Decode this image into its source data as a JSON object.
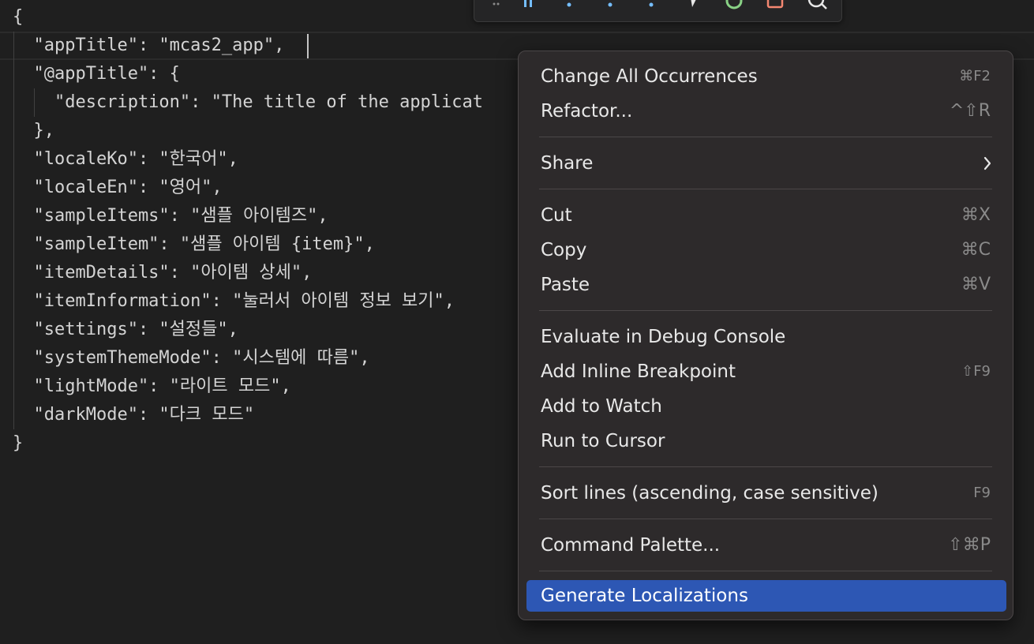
{
  "editor": {
    "lines": [
      "{",
      "  \"appTitle\": \"mcas2_app\",",
      "  \"@appTitle\": {",
      "    \"description\": \"The title of the applicat",
      "  },",
      "  \"localeKo\": \"한국어\",",
      "  \"localeEn\": \"영어\",",
      "  \"sampleItems\": \"샘플 아이템즈\",",
      "  \"sampleItem\": \"샘플 아이템 {item}\",",
      "  \"itemDetails\": \"아이템 상세\",",
      "  \"itemInformation\": \"눌러서 아이템 정보 보기\",",
      "  \"settings\": \"설정들\",",
      "  \"systemThemeMode\": \"시스템에 따름\",",
      "  \"lightMode\": \"라이트 모드\",",
      "  \"darkMode\": \"다크 모드\"",
      "}"
    ],
    "colors": {
      "background": "#1f1f1f",
      "text": "#d4d4d4"
    }
  },
  "debug_toolbar": {
    "icons": [
      "drag-handle-icon",
      "pause-icon",
      "step-over-icon",
      "step-into-icon",
      "step-out-icon",
      "hot-reload-icon",
      "restart-icon",
      "stop-icon",
      "inspect-icon"
    ]
  },
  "context_menu": {
    "items": [
      {
        "label": "Change All Occurrences",
        "shortcut": "⌘F2"
      },
      {
        "label": "Refactor...",
        "shortcut": "^⇧R"
      },
      {
        "label": "Share",
        "submenu": true
      },
      {
        "label": "Cut",
        "shortcut": "⌘X"
      },
      {
        "label": "Copy",
        "shortcut": "⌘C"
      },
      {
        "label": "Paste",
        "shortcut": "⌘V"
      },
      {
        "label": "Evaluate in Debug Console",
        "shortcut": ""
      },
      {
        "label": "Add Inline Breakpoint",
        "shortcut": "⇧F9"
      },
      {
        "label": "Add to Watch",
        "shortcut": ""
      },
      {
        "label": "Run to Cursor",
        "shortcut": ""
      },
      {
        "label": "Sort lines (ascending, case sensitive)",
        "shortcut": "F9"
      },
      {
        "label": "Command Palette...",
        "shortcut": "⇧⌘P"
      },
      {
        "label": "Generate Localizations",
        "shortcut": ""
      }
    ],
    "selected": "Generate Localizations",
    "colors": {
      "background": "#2d2a2b",
      "highlight": "#2d57b4"
    }
  }
}
